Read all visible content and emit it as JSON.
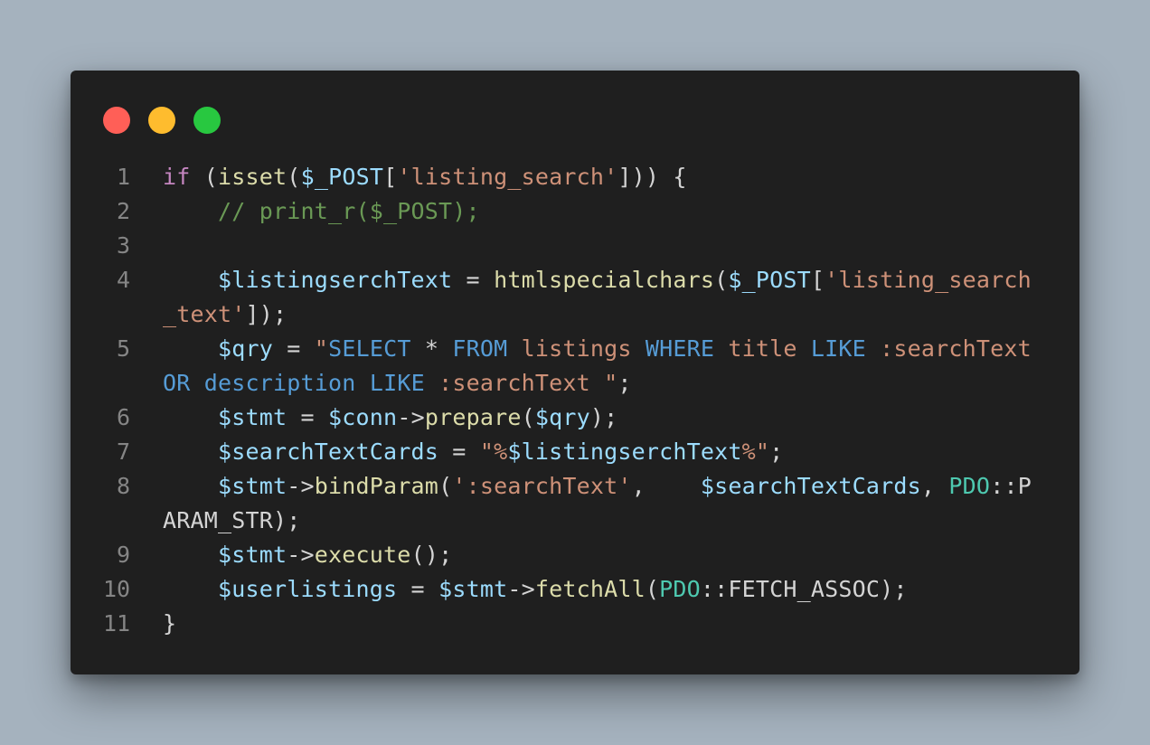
{
  "window": {
    "dots": [
      {
        "name": "close",
        "color": "#ff5f57"
      },
      {
        "name": "minimize",
        "color": "#febc2e"
      },
      {
        "name": "zoom",
        "color": "#28c840"
      }
    ]
  },
  "theme": {
    "keyword": "#c586c0",
    "function": "#dcdcaa",
    "variable": "#9cdcfe",
    "string": "#ce9178",
    "sql_keyword": "#569cd6",
    "comment": "#6a9955",
    "class": "#4ec9b0",
    "plain": "#d4d4d4"
  },
  "code": {
    "rows": [
      {
        "ln": "1",
        "tokens": [
          {
            "t": "if",
            "c": "keyword"
          },
          {
            "t": " ("
          },
          {
            "t": "isset",
            "c": "function"
          },
          {
            "t": "("
          },
          {
            "t": "$_POST",
            "c": "variable"
          },
          {
            "t": "["
          },
          {
            "t": "'listing_search'",
            "c": "string"
          },
          {
            "t": "])) {"
          }
        ]
      },
      {
        "ln": "2",
        "tokens": [
          {
            "t": "    "
          },
          {
            "t": "// print_r($_POST);",
            "c": "comment"
          }
        ]
      },
      {
        "ln": "3",
        "tokens": []
      },
      {
        "ln": "4",
        "tokens": [
          {
            "t": "    "
          },
          {
            "t": "$listingserchText",
            "c": "variable"
          },
          {
            "t": " = "
          },
          {
            "t": "htmlspecialchars",
            "c": "function"
          },
          {
            "t": "("
          },
          {
            "t": "$_POST",
            "c": "variable"
          },
          {
            "t": "["
          },
          {
            "t": "'listing_search",
            "c": "string"
          }
        ]
      },
      {
        "ln": "",
        "tokens": [
          {
            "t": "_text'",
            "c": "string"
          },
          {
            "t": "]);"
          }
        ]
      },
      {
        "ln": "5",
        "tokens": [
          {
            "t": "    "
          },
          {
            "t": "$qry",
            "c": "variable"
          },
          {
            "t": " = "
          },
          {
            "t": "\"",
            "c": "string"
          },
          {
            "t": "SELECT",
            "c": "sql_keyword"
          },
          {
            "t": " * "
          },
          {
            "t": "FROM",
            "c": "sql_keyword"
          },
          {
            "t": " listings ",
            "c": "string"
          },
          {
            "t": "WHERE",
            "c": "sql_keyword"
          },
          {
            "t": " title ",
            "c": "string"
          },
          {
            "t": "LIKE",
            "c": "sql_keyword"
          },
          {
            "t": " :searchText",
            "c": "string"
          }
        ]
      },
      {
        "ln": "",
        "tokens": [
          {
            "t": "OR",
            "c": "sql_keyword"
          },
          {
            "t": " "
          },
          {
            "t": "description",
            "c": "sql_keyword"
          },
          {
            "t": " "
          },
          {
            "t": "LIKE",
            "c": "sql_keyword"
          },
          {
            "t": " :searchText \"",
            "c": "string"
          },
          {
            "t": ";"
          }
        ]
      },
      {
        "ln": "6",
        "tokens": [
          {
            "t": "    "
          },
          {
            "t": "$stmt",
            "c": "variable"
          },
          {
            "t": " = "
          },
          {
            "t": "$conn",
            "c": "variable"
          },
          {
            "t": "->"
          },
          {
            "t": "prepare",
            "c": "function"
          },
          {
            "t": "("
          },
          {
            "t": "$qry",
            "c": "variable"
          },
          {
            "t": ");"
          }
        ]
      },
      {
        "ln": "7",
        "tokens": [
          {
            "t": "    "
          },
          {
            "t": "$searchTextCards",
            "c": "variable"
          },
          {
            "t": " = "
          },
          {
            "t": "\"%",
            "c": "string"
          },
          {
            "t": "$listingserchText",
            "c": "variable"
          },
          {
            "t": "%\"",
            "c": "string"
          },
          {
            "t": ";"
          }
        ]
      },
      {
        "ln": "8",
        "tokens": [
          {
            "t": "    "
          },
          {
            "t": "$stmt",
            "c": "variable"
          },
          {
            "t": "->"
          },
          {
            "t": "bindParam",
            "c": "function"
          },
          {
            "t": "("
          },
          {
            "t": "':searchText'",
            "c": "string"
          },
          {
            "t": ",    "
          },
          {
            "t": "$searchTextCards",
            "c": "variable"
          },
          {
            "t": ", "
          },
          {
            "t": "PDO",
            "c": "class"
          },
          {
            "t": "::P"
          }
        ]
      },
      {
        "ln": "",
        "tokens": [
          {
            "t": "ARAM_STR);"
          }
        ]
      },
      {
        "ln": "9",
        "tokens": [
          {
            "t": "    "
          },
          {
            "t": "$stmt",
            "c": "variable"
          },
          {
            "t": "->"
          },
          {
            "t": "execute",
            "c": "function"
          },
          {
            "t": "();"
          }
        ]
      },
      {
        "ln": "10",
        "tokens": [
          {
            "t": "    "
          },
          {
            "t": "$userlistings",
            "c": "variable"
          },
          {
            "t": " = "
          },
          {
            "t": "$stmt",
            "c": "variable"
          },
          {
            "t": "->"
          },
          {
            "t": "fetchAll",
            "c": "function"
          },
          {
            "t": "("
          },
          {
            "t": "PDO",
            "c": "class"
          },
          {
            "t": "::FETCH_ASSOC);"
          }
        ]
      },
      {
        "ln": "11",
        "tokens": [
          {
            "t": "}"
          }
        ]
      }
    ]
  }
}
